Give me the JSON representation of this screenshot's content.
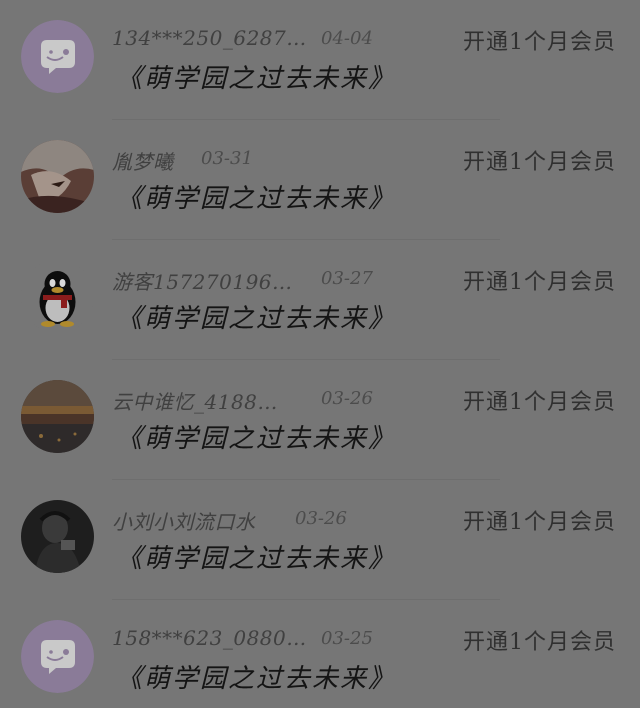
{
  "items": [
    {
      "name": "134***250_6287…",
      "date": "04-04",
      "action": "开通1个月会员",
      "title": "《萌学园之过去未来》",
      "avatar": "chat-bubble-icon"
    },
    {
      "name": "胤梦曦",
      "date": "03-31",
      "action": "开通1个月会员",
      "title": "《萌学园之过去未来》",
      "avatar": "anime-character-photo"
    },
    {
      "name": "游客157270196…",
      "date": "03-27",
      "action": "开通1个月会员",
      "title": "《萌学园之过去未来》",
      "avatar": "qq-penguin-icon"
    },
    {
      "name": "云中谁忆_4188…",
      "date": "03-26",
      "action": "开通1个月会员",
      "title": "《萌学园之过去未来》",
      "avatar": "sunset-landscape-photo"
    },
    {
      "name": "小刘小刘流口水",
      "date": "03-26",
      "action": "开通1个月会员",
      "title": "《萌学园之过去未来》",
      "avatar": "person-photo"
    },
    {
      "name": "158***623_0880…",
      "date": "03-25",
      "action": "开通1个月会员",
      "title": "《萌学园之过去未来》",
      "avatar": "chat-bubble-icon"
    }
  ],
  "colors": {
    "overlay": "#767676",
    "bubble_avatar_bg": "#8a7b98"
  }
}
